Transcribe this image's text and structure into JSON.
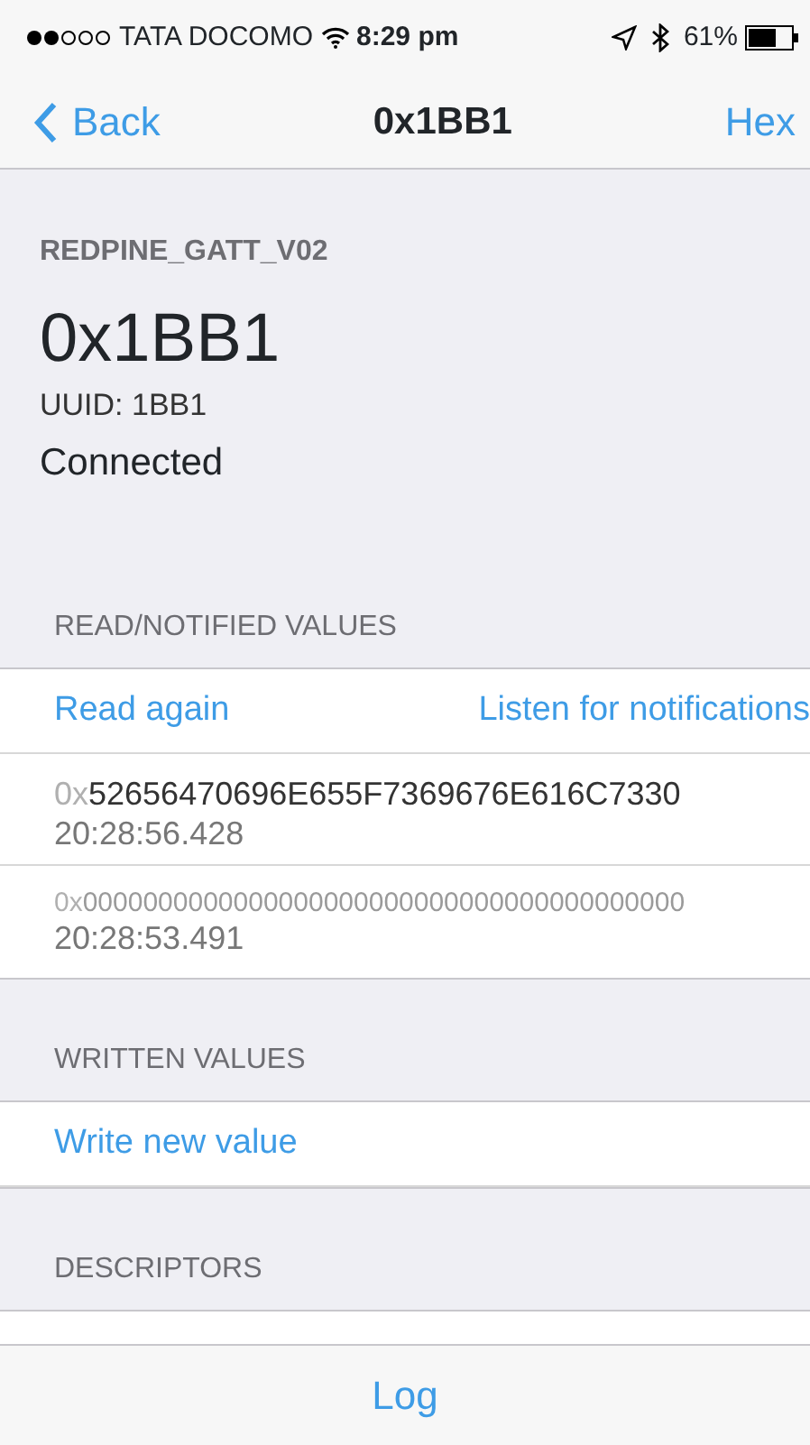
{
  "status_bar": {
    "carrier": "TATA DOCOMO",
    "time": "8:29 pm",
    "battery": "61%"
  },
  "nav": {
    "back": "Back",
    "title": "0x1BB1",
    "action": "Hex"
  },
  "device": {
    "name": "REDPINE_GATT_V02",
    "characteristic": "0x1BB1",
    "uuid": "UUID: 1BB1",
    "state": "Connected"
  },
  "sections": [
    {
      "title": "READ/NOTIFIED VALUES",
      "actions": [
        "Read again",
        "Listen for notifications"
      ],
      "values": [
        {
          "prefix": "0x",
          "value": "52656470696E655F7369676E616C7330",
          "time": "20:28:56.428",
          "faded": false
        },
        {
          "prefix": "0x",
          "value": "0000000000000000000000000000000000000000",
          "time": "20:28:53.491",
          "faded": true
        }
      ]
    },
    {
      "title": "WRITTEN VALUES",
      "actions": [
        "Write new value"
      ]
    },
    {
      "title": "DESCRIPTORS"
    }
  ],
  "toolbar": {
    "button": "Log"
  }
}
